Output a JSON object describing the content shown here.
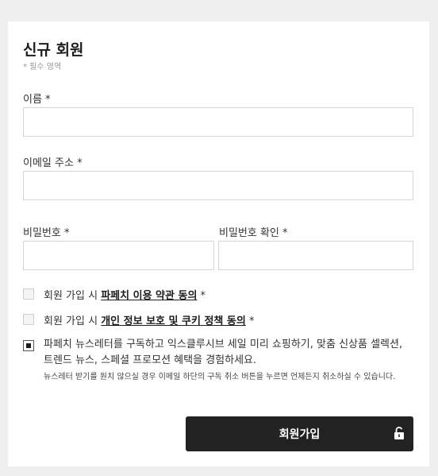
{
  "form": {
    "title": "신규 회원",
    "required_note": "* 필수 영역"
  },
  "fields": {
    "name": {
      "label": "이름 *",
      "value": "",
      "placeholder": ""
    },
    "email": {
      "label": "이메일 주소 *",
      "value": "",
      "placeholder": ""
    },
    "password": {
      "label": "비밀번호 *",
      "value": "",
      "placeholder": ""
    },
    "password_confirm": {
      "label": "비밀번호 확인 *",
      "value": "",
      "placeholder": ""
    }
  },
  "consents": {
    "terms": {
      "prefix": "회원 가입 시 ",
      "link": "파페치 이용 약관 동의",
      "suffix": " *",
      "checked": false
    },
    "privacy": {
      "prefix": "회원 가입 시 ",
      "link": "개인 정보 보호 및 쿠키 정책 동의",
      "suffix": " *",
      "checked": false
    },
    "newsletter": {
      "text": "파페치 뉴스레터를 구독하고 익스클루시브 세일 미리 쇼핑하기, 맞춤 신상품 셀렉션, 트렌드 뉴스, 스페셜 프로모션 혜택을 경험하세요.",
      "subtext": "뉴스레터 받기를 원치 않으실 경우 이메일 하단의 구독 취소 버튼을 누르면 언제든지 취소하실 수 있습니다.",
      "checked": true
    }
  },
  "submit": {
    "label": "회원가입",
    "icon": "unlock-icon"
  },
  "colors": {
    "background": "#efefef",
    "card": "#ffffff",
    "button": "#222222",
    "input_border": "#d5d5d5"
  }
}
